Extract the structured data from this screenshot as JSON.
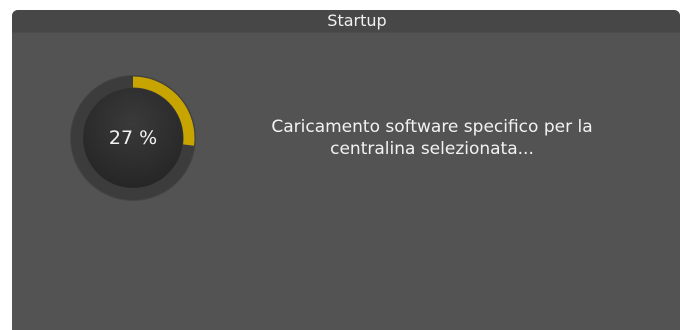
{
  "window": {
    "title": "Startup"
  },
  "progress": {
    "percent": 27,
    "label": "27 %",
    "accent_color": "#c8a400",
    "track_color": "#3c3c3c"
  },
  "status": {
    "line1": "Caricamento software specifico per la",
    "line2": "centralina selezionata..."
  }
}
